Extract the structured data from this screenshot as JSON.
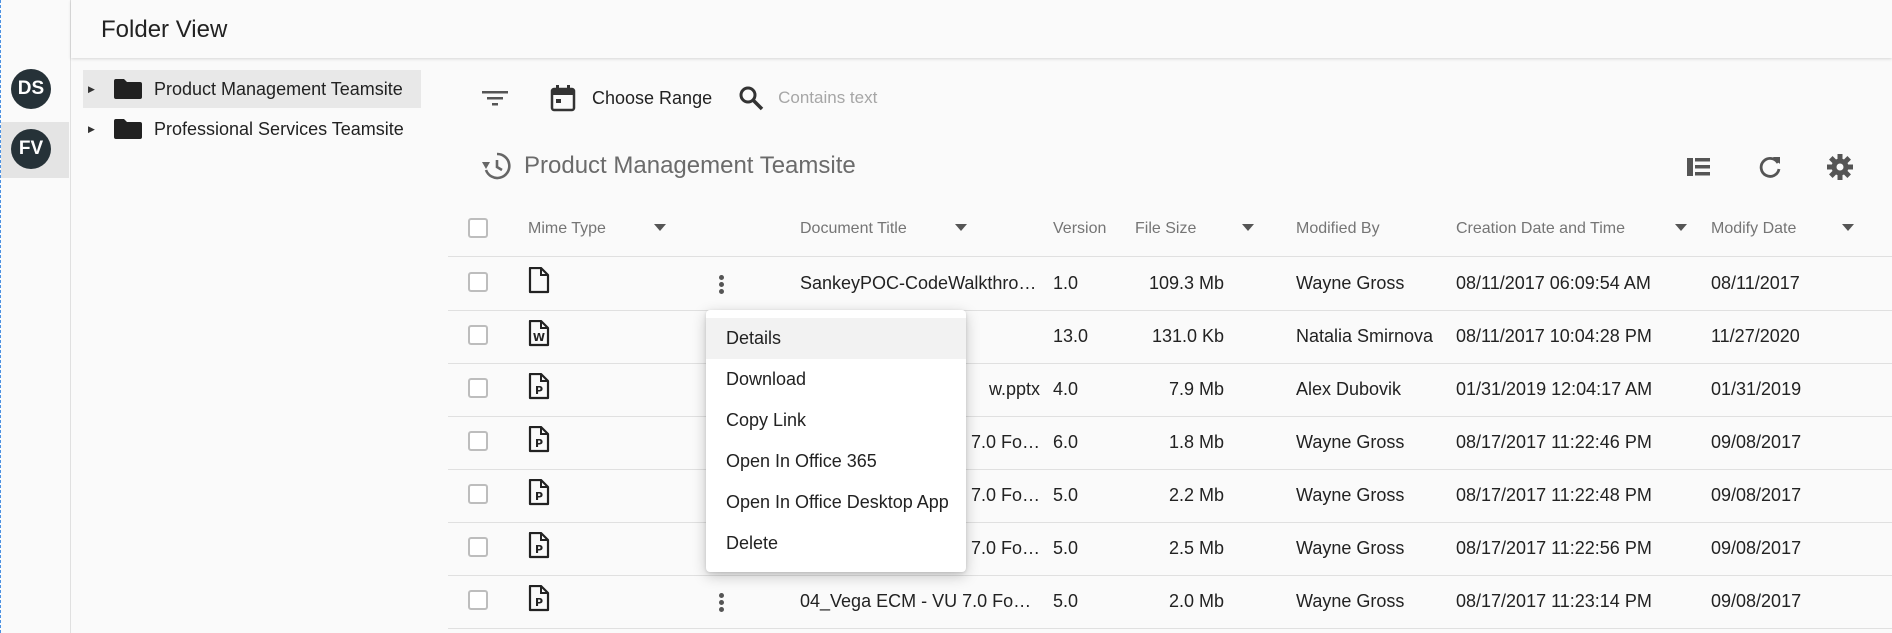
{
  "app": {
    "title": "Folder View"
  },
  "rail": {
    "avatars": [
      {
        "initials": "DS"
      },
      {
        "initials": "FV"
      }
    ]
  },
  "tree": {
    "items": [
      {
        "label": "Product Management Teamsite",
        "selected": true
      },
      {
        "label": "Professional Services Teamsite",
        "selected": false
      }
    ]
  },
  "toolbar": {
    "filter_icon": "filter-icon",
    "date_range_label": "Choose Range",
    "search_placeholder": "Contains text"
  },
  "section": {
    "title": "Product Management Teamsite",
    "history_icon": "history-icon",
    "actions": [
      "view-columns-icon",
      "refresh-icon",
      "settings-icon"
    ]
  },
  "table": {
    "headers": {
      "mime_type": "Mime Type",
      "document_title": "Document Title",
      "version": "Version",
      "file_size": "File Size",
      "modified_by": "Modified By",
      "creation_date": "Creation Date and Time",
      "modify_date": "Modify Date"
    },
    "rows": [
      {
        "mime": "document",
        "title": "SankeyPOC-CodeWalkthro…",
        "version": "1.0",
        "size": "109.3 Mb",
        "modified_by": "Wayne Gross",
        "created": "08/11/2017 06:09:54 AM",
        "modified": "08/11/2017",
        "kebab": true
      },
      {
        "mime": "word",
        "title": "",
        "version": "13.0",
        "size": "131.0 Kb",
        "modified_by": "Natalia Smirnova",
        "created": "08/11/2017 10:04:28 PM",
        "modified": "11/27/2020",
        "kebab": false
      },
      {
        "mime": "powerpoint",
        "title": "w.pptx",
        "version": "4.0",
        "size": "7.9 Mb",
        "modified_by": "Alex Dubovik",
        "created": "01/31/2019 12:04:17 AM",
        "modified": "01/31/2019",
        "kebab": false
      },
      {
        "mime": "powerpoint",
        "title": "7.0 Fo…",
        "version": "6.0",
        "size": "1.8 Mb",
        "modified_by": "Wayne Gross",
        "created": "08/17/2017 11:22:46 PM",
        "modified": "09/08/2017",
        "kebab": false
      },
      {
        "mime": "powerpoint",
        "title": "7.0 Fo…",
        "version": "5.0",
        "size": "2.2 Mb",
        "modified_by": "Wayne Gross",
        "created": "08/17/2017 11:22:48 PM",
        "modified": "09/08/2017",
        "kebab": false
      },
      {
        "mime": "powerpoint",
        "title": "7.0 Fo…",
        "version": "5.0",
        "size": "2.5 Mb",
        "modified_by": "Wayne Gross",
        "created": "08/17/2017 11:22:56 PM",
        "modified": "09/08/2017",
        "kebab": false
      },
      {
        "mime": "powerpoint",
        "title": "04_Vega ECM - VU 7.0 Fo…",
        "version": "5.0",
        "size": "2.0 Mb",
        "modified_by": "Wayne Gross",
        "created": "08/17/2017 11:23:14 PM",
        "modified": "09/08/2017",
        "kebab": true
      }
    ]
  },
  "context_menu": {
    "items": [
      "Details",
      "Download",
      "Copy Link",
      "Open In Office 365",
      "Open In Office Desktop App",
      "Delete"
    ],
    "highlighted": "Details"
  },
  "colors": {
    "avatar_bg": "#263238",
    "text": "#222222",
    "muted": "#757575",
    "selection_bg": "#e8e8e8"
  }
}
